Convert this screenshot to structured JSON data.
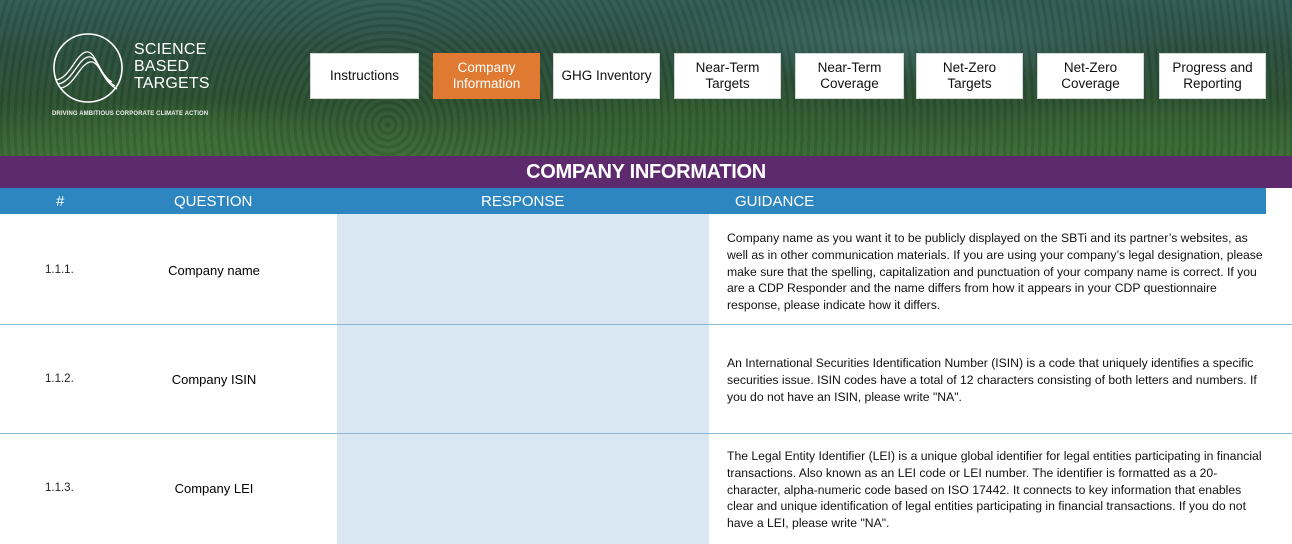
{
  "logo": {
    "line1": "SCIENCE",
    "line2": "BASED",
    "line3": "TARGETS",
    "tagline": "DRIVING AMBITIOUS CORPORATE CLIMATE ACTION"
  },
  "nav": [
    {
      "label": "Instructions",
      "active": false
    },
    {
      "label": "Company Information",
      "active": true
    },
    {
      "label": "GHG Inventory",
      "active": false
    },
    {
      "label": "Near-Term Targets",
      "active": false
    },
    {
      "label": "Near-Term Coverage",
      "active": false
    },
    {
      "label": "Net-Zero Targets",
      "active": false
    },
    {
      "label": "Net-Zero Coverage",
      "active": false
    },
    {
      "label": "Progress and Reporting",
      "active": false
    }
  ],
  "section_title": "COMPANY INFORMATION",
  "columns": {
    "num": "#",
    "question": "QUESTION",
    "response": "RESPONSE",
    "guidance": "GUIDANCE"
  },
  "rows": [
    {
      "num": "1.1.1.",
      "question": "Company name",
      "response": "",
      "guidance": "Company name as you want it to be publicly displayed on the SBTi and its partner’s websites, as well as in other communication materials. If you are using your company’s legal designation, please make sure that the spelling, capitalization and punctuation of your company name is correct. If you are a CDP Responder and the name differs from how it appears in your CDP questionnaire response, please indicate how it differs."
    },
    {
      "num": "1.1.2.",
      "question": "Company ISIN",
      "response": "",
      "guidance": "An International Securities Identification Number (ISIN) is a code that uniquely identifies a specific securities issue. ISIN codes have a total of 12 characters consisting of both letters and numbers. If you do not have an ISIN, please write \"NA\"."
    },
    {
      "num": "1.1.3.",
      "question": "Company LEI",
      "response": "",
      "guidance": "The Legal Entity Identifier (LEI) is a unique global identifier for legal entities participating in financial transactions. Also known as an LEI code or LEI number. The identifier is formatted as a 20-character, alpha-numeric code based on ISO 17442. It connects to key information that enables clear and unique identification of legal entities participating in financial transactions. If you do not have a LEI, please write \"NA\"."
    }
  ],
  "colors": {
    "accent": "#e07a32",
    "title_bar": "#5e2a6e",
    "column_bar": "#2e86c1",
    "response_fill": "#d9e7f3"
  }
}
